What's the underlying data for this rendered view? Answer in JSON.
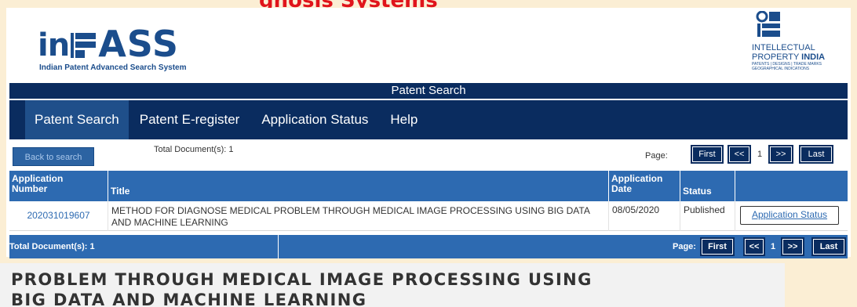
{
  "top_caption": "gnosis Systems",
  "logo": {
    "in_text": "in",
    "ass_text": "ASS",
    "subtitle": "Indian Patent Advanced Search System"
  },
  "ipi_logo": {
    "line1": "INTELLECTUAL",
    "line2_prefix": "PROPERTY ",
    "line2_bold": "INDIA",
    "line3": "PATENTS | DESIGNS | TRADE MARKS",
    "line4": "GEOGRAPHICAL INDICATIONS"
  },
  "title_bar": "Patent Search",
  "nav": [
    {
      "label": "Patent Search"
    },
    {
      "label": "Patent E-register"
    },
    {
      "label": "Application Status"
    },
    {
      "label": "Help"
    }
  ],
  "toolbar": {
    "back_label": "Back to search",
    "total_label": "Total Document(s): 1",
    "page_label": "Page:",
    "first": "First",
    "prev": "<<",
    "current": "1",
    "next": ">>",
    "last": "Last"
  },
  "table": {
    "headers": {
      "app_number_line1": "Application",
      "app_number_line2": "Number",
      "title": "Title",
      "app_date_line1": "Application",
      "app_date_line2": "Date",
      "status": "Status"
    },
    "rows": [
      {
        "app_number": "202031019607",
        "title": "METHOD FOR DIAGNOSE MEDICAL PROBLEM THROUGH MEDICAL IMAGE PROCESSING USING BIG DATA AND MACHINE LEARNING",
        "app_date": "08/05/2020",
        "status": "Published",
        "action": "Application Status"
      }
    ]
  },
  "footer": {
    "total_label": "Total Document(s): 1",
    "page_label": "Page:",
    "first": "First",
    "prev": "<<",
    "current": "1",
    "next": ">>",
    "last": "Last"
  },
  "banner": {
    "line1": "PROBLEM THROUGH MEDICAL IMAGE PROCESSING USING",
    "line2": "BIG DATA AND MACHINE LEARNING"
  },
  "colors": {
    "navy": "#0a2c5f",
    "table_blue": "#2d6ab1",
    "caption_red": "#e0141b",
    "background": "#fbeed4"
  }
}
